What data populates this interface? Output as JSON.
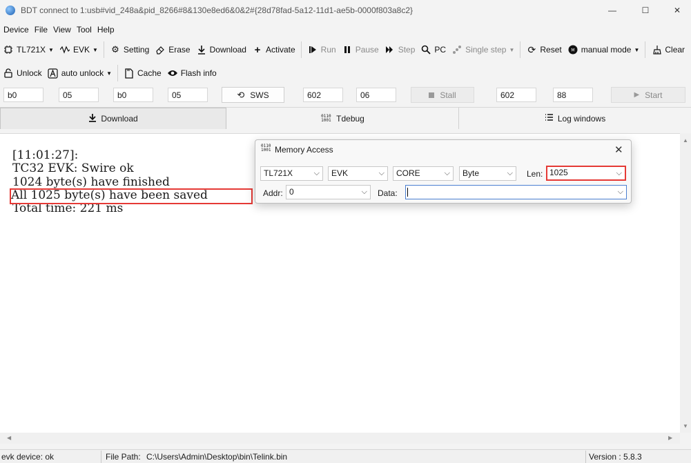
{
  "window": {
    "title": "BDT connect to 1:usb#vid_248a&pid_8266#8&130e8ed6&0&2#{28d78fad-5a12-11d1-ae5b-0000f803a8c2}",
    "minimize": "—",
    "maximize": "☐",
    "close": "✕"
  },
  "menu": [
    "Device",
    "File",
    "View",
    "Tool",
    "Help"
  ],
  "toolbar1": {
    "chip": "TL721X",
    "board": "EVK",
    "setting": "Setting",
    "erase": "Erase",
    "download": "Download",
    "activate": "Activate",
    "run": "Run",
    "pause": "Pause",
    "step": "Step",
    "pc": "PC",
    "single_step": "Single step",
    "reset": "Reset",
    "mode": "manual mode",
    "clear": "Clear"
  },
  "toolbar2": {
    "unlock": "Unlock",
    "auto_unlock": "auto unlock",
    "cache": "Cache",
    "flash_info": "Flash info"
  },
  "values_row": {
    "fields": [
      "b0",
      "05",
      "b0",
      "05"
    ],
    "sws_label": "SWS",
    "fields2": [
      "602",
      "06"
    ],
    "stall_label": "Stall",
    "fields3": [
      "602",
      "88"
    ],
    "start_label": "Start"
  },
  "tabs": {
    "download": "Download",
    "tdebug": "Tdebug",
    "log_windows": "Log windows"
  },
  "log": {
    "lines": [
      "[11:01:27]:",
      "TC32 EVK: Swire ok",
      "1024 byte(s) have finished",
      "All 1025 byte(s) have been saved",
      "Total time: 221 ms"
    ]
  },
  "status": {
    "device": "evk device: ok",
    "file_path_label": "File Path:",
    "file_path": "C:\\Users\\Admin\\Desktop\\bin\\Telink.bin",
    "version": "Version : 5.8.3"
  },
  "dialog": {
    "title": "Memory Access",
    "icon_text": "0110\n1001",
    "chip": "TL721X",
    "board": "EVK",
    "region": "CORE",
    "unit": "Byte",
    "len_label": "Len:",
    "len_value": "1025",
    "addr_label": "Addr:",
    "addr_value": "0",
    "data_label": "Data:",
    "data_value": ""
  },
  "colors": {
    "highlight": "#e53935",
    "log_bg": "#ffffff",
    "chrome_bg": "#f3f3f3"
  }
}
